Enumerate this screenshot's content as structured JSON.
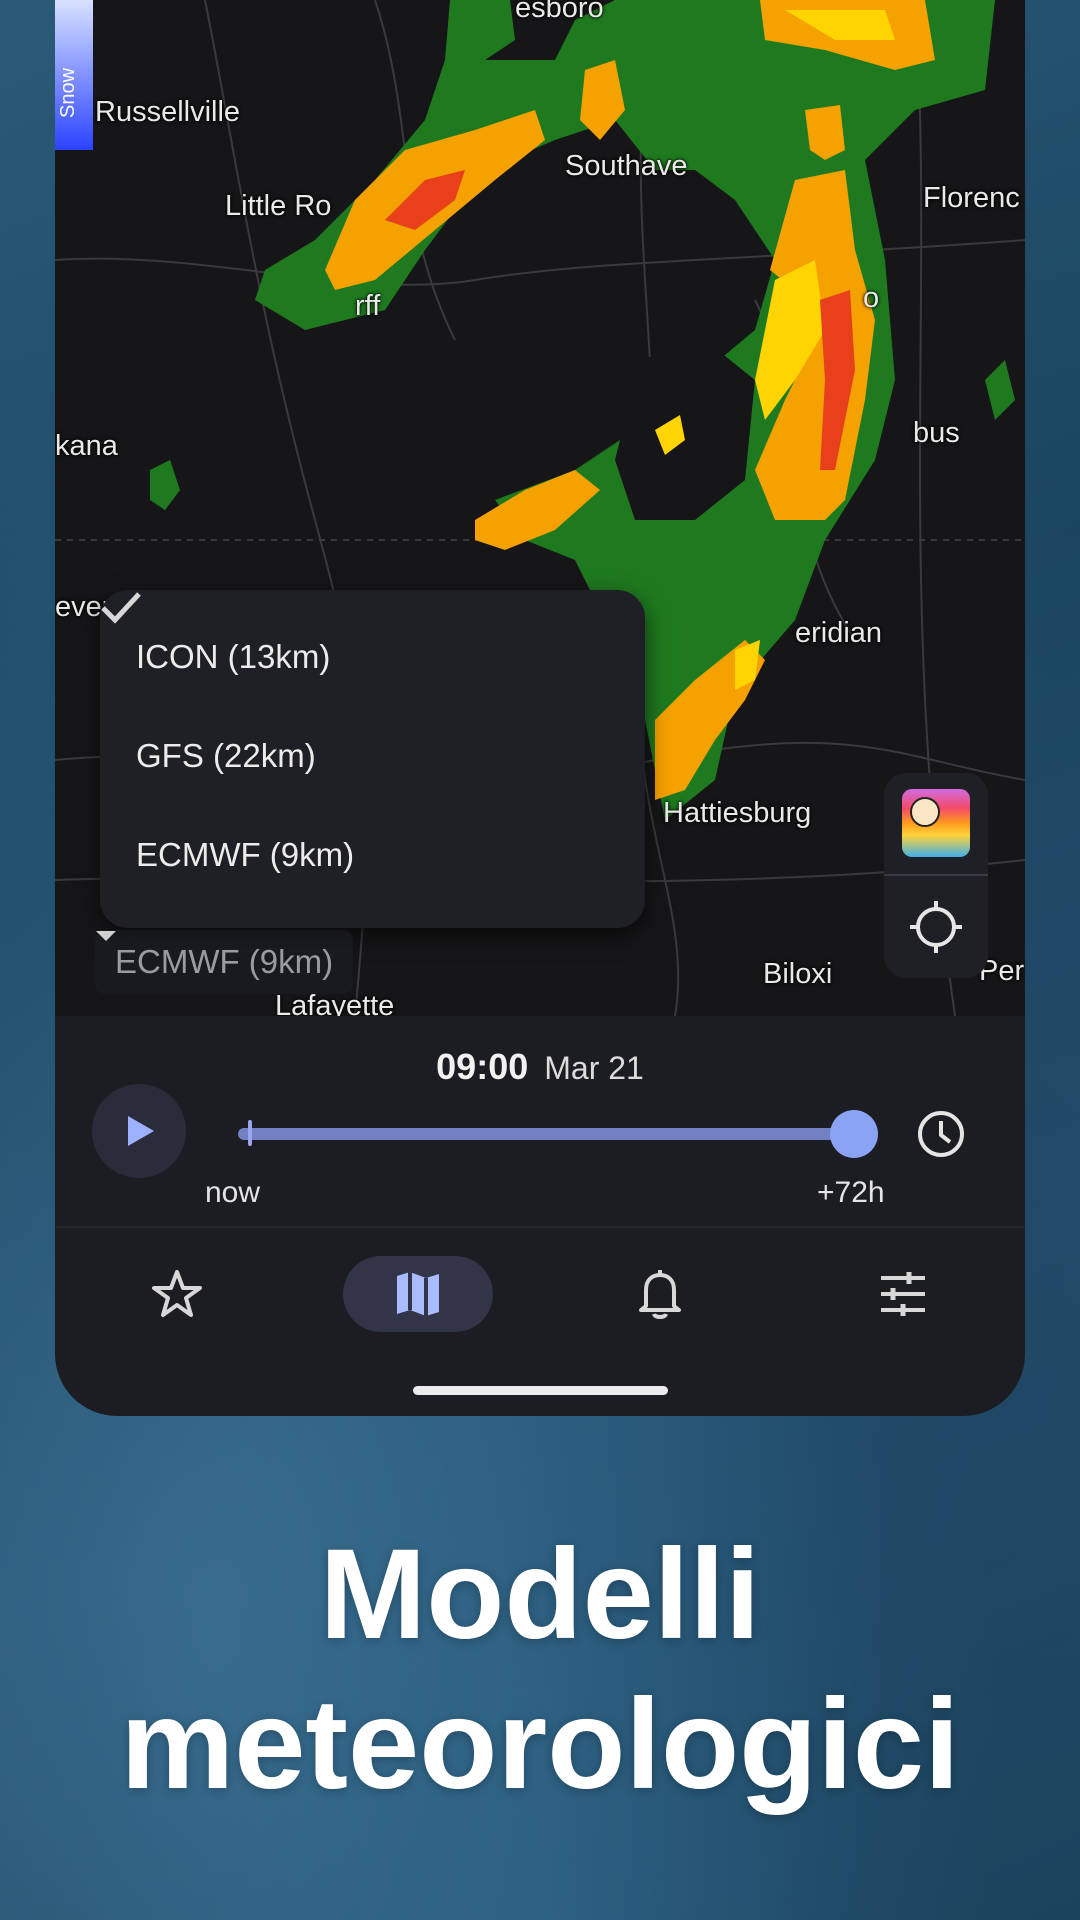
{
  "map": {
    "cities": [
      "esboro",
      "Russellville",
      "Little Ro",
      "Southave",
      "Florenc",
      "rff",
      "o",
      "kana",
      "bus",
      "ever",
      "eridian",
      "Hattiesburg",
      "Biloxi",
      "Per",
      "Lafayette"
    ],
    "legend_label": "Snow"
  },
  "model_menu": {
    "options": [
      "ICON (13km)",
      "GFS (22km)",
      "ECMWF (9km)"
    ],
    "selected": "ECMWF (9km)"
  },
  "model_button_label": "ECMWF (9km)",
  "timeline": {
    "time": "09:00",
    "date": "Mar 21",
    "start_label": "now",
    "end_label": "+72h",
    "position": 1.0
  },
  "icons": {
    "fab": [
      "app-logo-icon",
      "locate-icon"
    ],
    "player": [
      "play-icon",
      "clock-icon"
    ],
    "nav": [
      "star-icon",
      "map-icon",
      "bell-icon",
      "sliders-icon"
    ]
  },
  "colors": {
    "accent": "#8aa3f5",
    "radar_green": "#1f7a1f",
    "radar_yellow": "#ffd400",
    "radar_red": "#e8401a"
  },
  "promo": {
    "headline_line1": "Modelli",
    "headline_line2": "meteorologici"
  }
}
